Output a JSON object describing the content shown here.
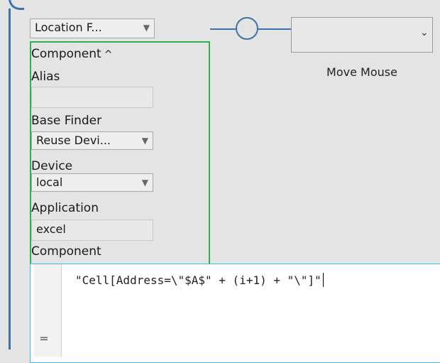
{
  "location_finder": {
    "selected": "Location F...",
    "arrow_icon": "dropdown-arrow"
  },
  "component_group": {
    "header": "Component",
    "toggle_icon": "caret-up-icon",
    "fields": {
      "alias": {
        "label": "Alias",
        "value": ""
      },
      "base_finder": {
        "label": "Base Finder",
        "selected": "Reuse Devi..."
      },
      "device": {
        "label": "Device",
        "selected": "local"
      },
      "application": {
        "label": "Application",
        "value": "excel"
      },
      "component": {
        "label": "Component"
      }
    }
  },
  "step": {
    "title": "Move Mouse",
    "dropdown_icon": "chevron-down-icon"
  },
  "editor": {
    "code": "\"Cell[Address=\\\"$A$\" + (i+1) + \"\\\"]\"",
    "gutter_icon": "equals-icon",
    "gutter_glyph": "="
  },
  "colors": {
    "flow_line": "#3d73a8",
    "group_border": "#2fb24c",
    "editor_focus": "#45b8e8"
  }
}
